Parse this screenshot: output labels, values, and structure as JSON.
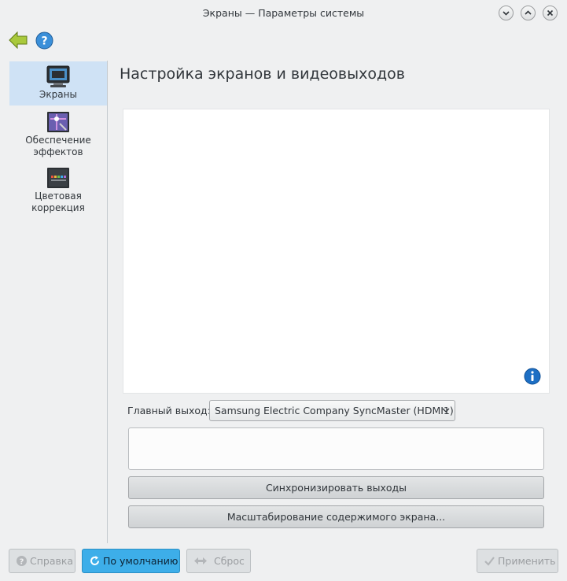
{
  "window": {
    "title": "Экраны — Параметры системы",
    "controls": [
      "minimize",
      "maximize",
      "close"
    ]
  },
  "toolbar": {
    "back_icon": "back-arrow-icon",
    "help_icon": "help-icon"
  },
  "sidebar": {
    "items": [
      {
        "label": "Экраны",
        "icon": "displays-icon",
        "active": true
      },
      {
        "label": "Обеспечение эффектов",
        "line1": "Обеспечение",
        "line2": "эффектов",
        "icon": "effects-icon",
        "active": false
      },
      {
        "label": "Цветовая коррекция",
        "line1": "Цветовая",
        "line2": "коррекция",
        "icon": "color-correction-icon",
        "active": false
      }
    ]
  },
  "main": {
    "title": "Настройка экранов и видеовыходов",
    "primary_output_label": "Главный выход:",
    "primary_output_value": "Samsung Electric Company SyncMaster (HDMI1)",
    "sync_button": "Синхронизировать выходы",
    "scale_button": "Масштабирование содержимого экрана..."
  },
  "buttons": {
    "help": "Справка",
    "defaults": "По умолчанию",
    "reset": "Сброс",
    "apply": "Применить"
  },
  "colors": {
    "accent": "#3daee9",
    "selection": "#cfe2f5",
    "background": "#eff0f1"
  }
}
